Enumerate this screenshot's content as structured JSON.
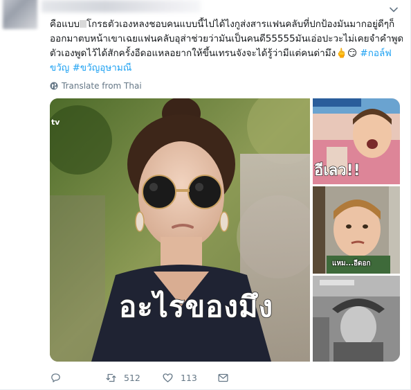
{
  "tweet": {
    "lines": [
      {
        "before": "คือแบบ",
        "after": "โกรธตัวเองหลงชอบคนแบบนี้ไปได้ไงกูส่งสารแฟนคลับที่ปกป้องมันมากอยู่ดีๆก็"
      },
      {
        "text": "ออกมาตบหน้าเขาเฉยแฟนคลับอุส่าช่วยว่ามันเป็นคนดี55555มันเอ่อปะวะไม่เคยจำคำพูดที่"
      },
      {
        "text": "ตัวเองพูดไว้ได้สักครั้งอีดอแหลอยากให้ขึ้นเทรนจังจะได้รู้ว่ามีแต่คนด่ามึง🖕😏",
        "hashtag1": "#กอล์ฟ"
      },
      {
        "hashtag2": "ขวัญ",
        "hashtag3": "#ขวัญอุษามณี"
      }
    ]
  },
  "translate_label": "Translate from Thai",
  "media": {
    "main_caption": "อะไรของมึง",
    "side1_caption": "อีเลว!!",
    "side2_caption": "แหม...อีดอก"
  },
  "actions": {
    "reply_count": "",
    "retweet_count": "512",
    "like_count": "113"
  },
  "colors": {
    "link": "#1da1f2",
    "muted": "#657786",
    "text": "#14171a"
  },
  "icons": [
    "caret-down-icon",
    "globe-icon",
    "reply-icon",
    "retweet-icon",
    "like-icon",
    "message-icon"
  ]
}
